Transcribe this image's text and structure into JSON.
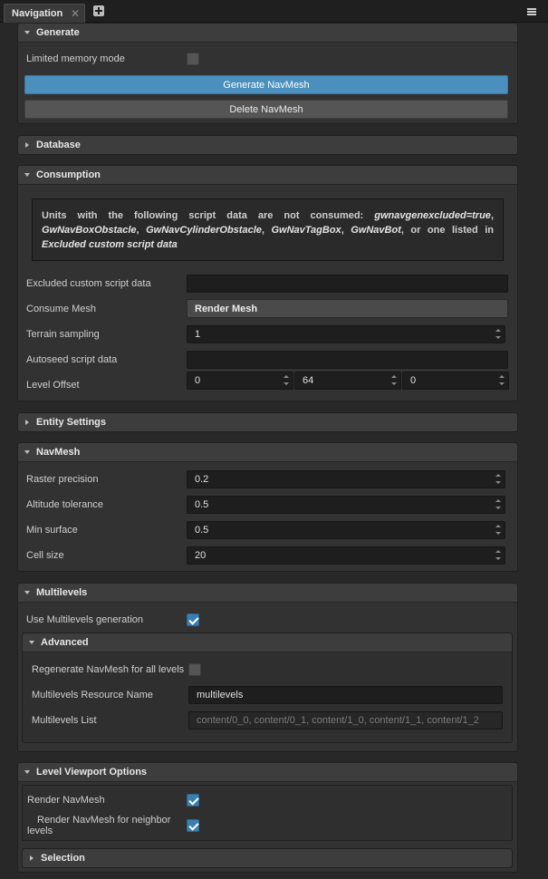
{
  "tabbar": {
    "active_tab": "Navigation",
    "close_glyph": "✕",
    "add_icon": "plus-square-icon",
    "menu_icon": "hamburger-menu-icon"
  },
  "generate": {
    "title": "Generate",
    "limited_memory_label": "Limited memory mode",
    "limited_memory_checked": false,
    "generate_button": "Generate NavMesh",
    "delete_button": "Delete NavMesh"
  },
  "database": {
    "title": "Database"
  },
  "consumption": {
    "title": "Consumption",
    "note_line1_prefix": "Units with the following script data are not consumed:",
    "note_flag": "gwnavgenexcluded=true",
    "note_obstacle1": "GwNavBoxObstacle",
    "note_obstacle2": "GwNavCylinderObstacle",
    "note_tagbox": "GwNavTagBox",
    "note_bot": "GwNavBot",
    "note_or_text": ", or one listed in",
    "note_excluded": "Excluded custom script data",
    "excluded_label": "Excluded custom script data",
    "excluded_value": "",
    "consume_mesh_label": "Consume Mesh",
    "consume_mesh_value": "Render Mesh",
    "terrain_label": "Terrain sampling",
    "terrain_value": "1",
    "autoseed_label": "Autoseed script data",
    "autoseed_value": "",
    "level_offset_label": "Level Offset",
    "level_offset_x": "0",
    "level_offset_y": "64",
    "level_offset_z": "0"
  },
  "entity_settings": {
    "title": "Entity Settings"
  },
  "navmesh": {
    "title": "NavMesh",
    "raster_label": "Raster precision",
    "raster_value": "0.2",
    "altitude_label": "Altitude tolerance",
    "altitude_value": "0.5",
    "min_surface_label": "Min surface",
    "min_surface_value": "0.5",
    "cell_size_label": "Cell size",
    "cell_size_value": "20"
  },
  "multilevels": {
    "title": "Multilevels",
    "use_label": "Use Multilevels generation",
    "use_checked": true,
    "advanced_title": "Advanced",
    "regenerate_label": "Regenerate NavMesh for all levels",
    "regenerate_checked": false,
    "resource_name_label": "Multilevels Resource Name",
    "resource_name_value": "multilevels",
    "list_label": "Multilevels List",
    "list_value": "content/0_0, content/0_1, content/1_0, content/1_1, content/1_2"
  },
  "viewport": {
    "title": "Level Viewport Options",
    "render_label": "Render NavMesh",
    "render_checked": true,
    "render_neighbor_label_1": "Render NavMesh for neighbor",
    "render_neighbor_label_2": "levels",
    "render_neighbor_checked": true,
    "selection_title": "Selection"
  }
}
